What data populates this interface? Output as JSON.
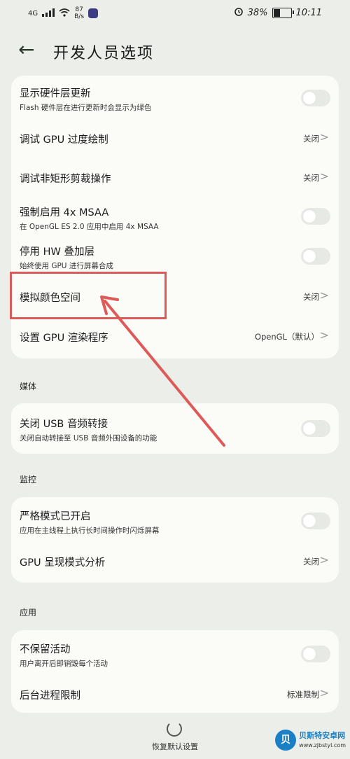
{
  "status": {
    "network": "4G",
    "speed_value": "87",
    "speed_unit": "B/s",
    "battery_pct": "38%",
    "battery_level": 0.38,
    "time": "10:11"
  },
  "header": {
    "title": "开发人员选项"
  },
  "rows": {
    "hw_layer": {
      "title": "显示硬件层更新",
      "sub": "Flash 硬件层在进行更新时会显示为绿色"
    },
    "gpu_overdraw": {
      "title": "调试 GPU 过度绘制",
      "value": "关闭"
    },
    "non_rect_clip": {
      "title": "调试非矩形剪裁操作",
      "value": "关闭"
    },
    "msaa": {
      "title": "强制启用 4x MSAA",
      "sub": "在 OpenGL ES 2.0 应用中启用 4x MSAA"
    },
    "hw_overlay": {
      "title": "停用 HW 叠加层",
      "sub": "始终使用 GPU 进行屏幕合成"
    },
    "color_space": {
      "title": "模拟颜色空间",
      "value": "关闭"
    },
    "gpu_renderer": {
      "title": "设置 GPU 渲染程序",
      "value": "OpenGL（默认）"
    },
    "usb_audio": {
      "title": "关闭 USB 音频转接",
      "sub": "关闭自动转接至 USB 音频外围设备的功能"
    },
    "strict_mode": {
      "title": "严格模式已开启",
      "sub": "应用在主线程上执行长时间操作时闪烁屏幕"
    },
    "gpu_profile": {
      "title": "GPU 呈现模式分析",
      "value": "关闭"
    },
    "dont_keep": {
      "title": "不保留活动",
      "sub": "用户离开后即销毁每个活动"
    },
    "bg_limit": {
      "title": "后台进程限制",
      "value": "标准限制"
    }
  },
  "sections": {
    "media": "媒体",
    "monitor": "监控",
    "apps": "应用"
  },
  "bottom": {
    "reset_label": "恢复默认设置"
  },
  "watermark": {
    "logo_char": "贝",
    "name": "贝斯特安卓网",
    "url": "www.zjbstyl.com"
  },
  "colors": {
    "background": "#ecefe9",
    "card": "#fbfbf8",
    "annotation": "#de5a58"
  }
}
